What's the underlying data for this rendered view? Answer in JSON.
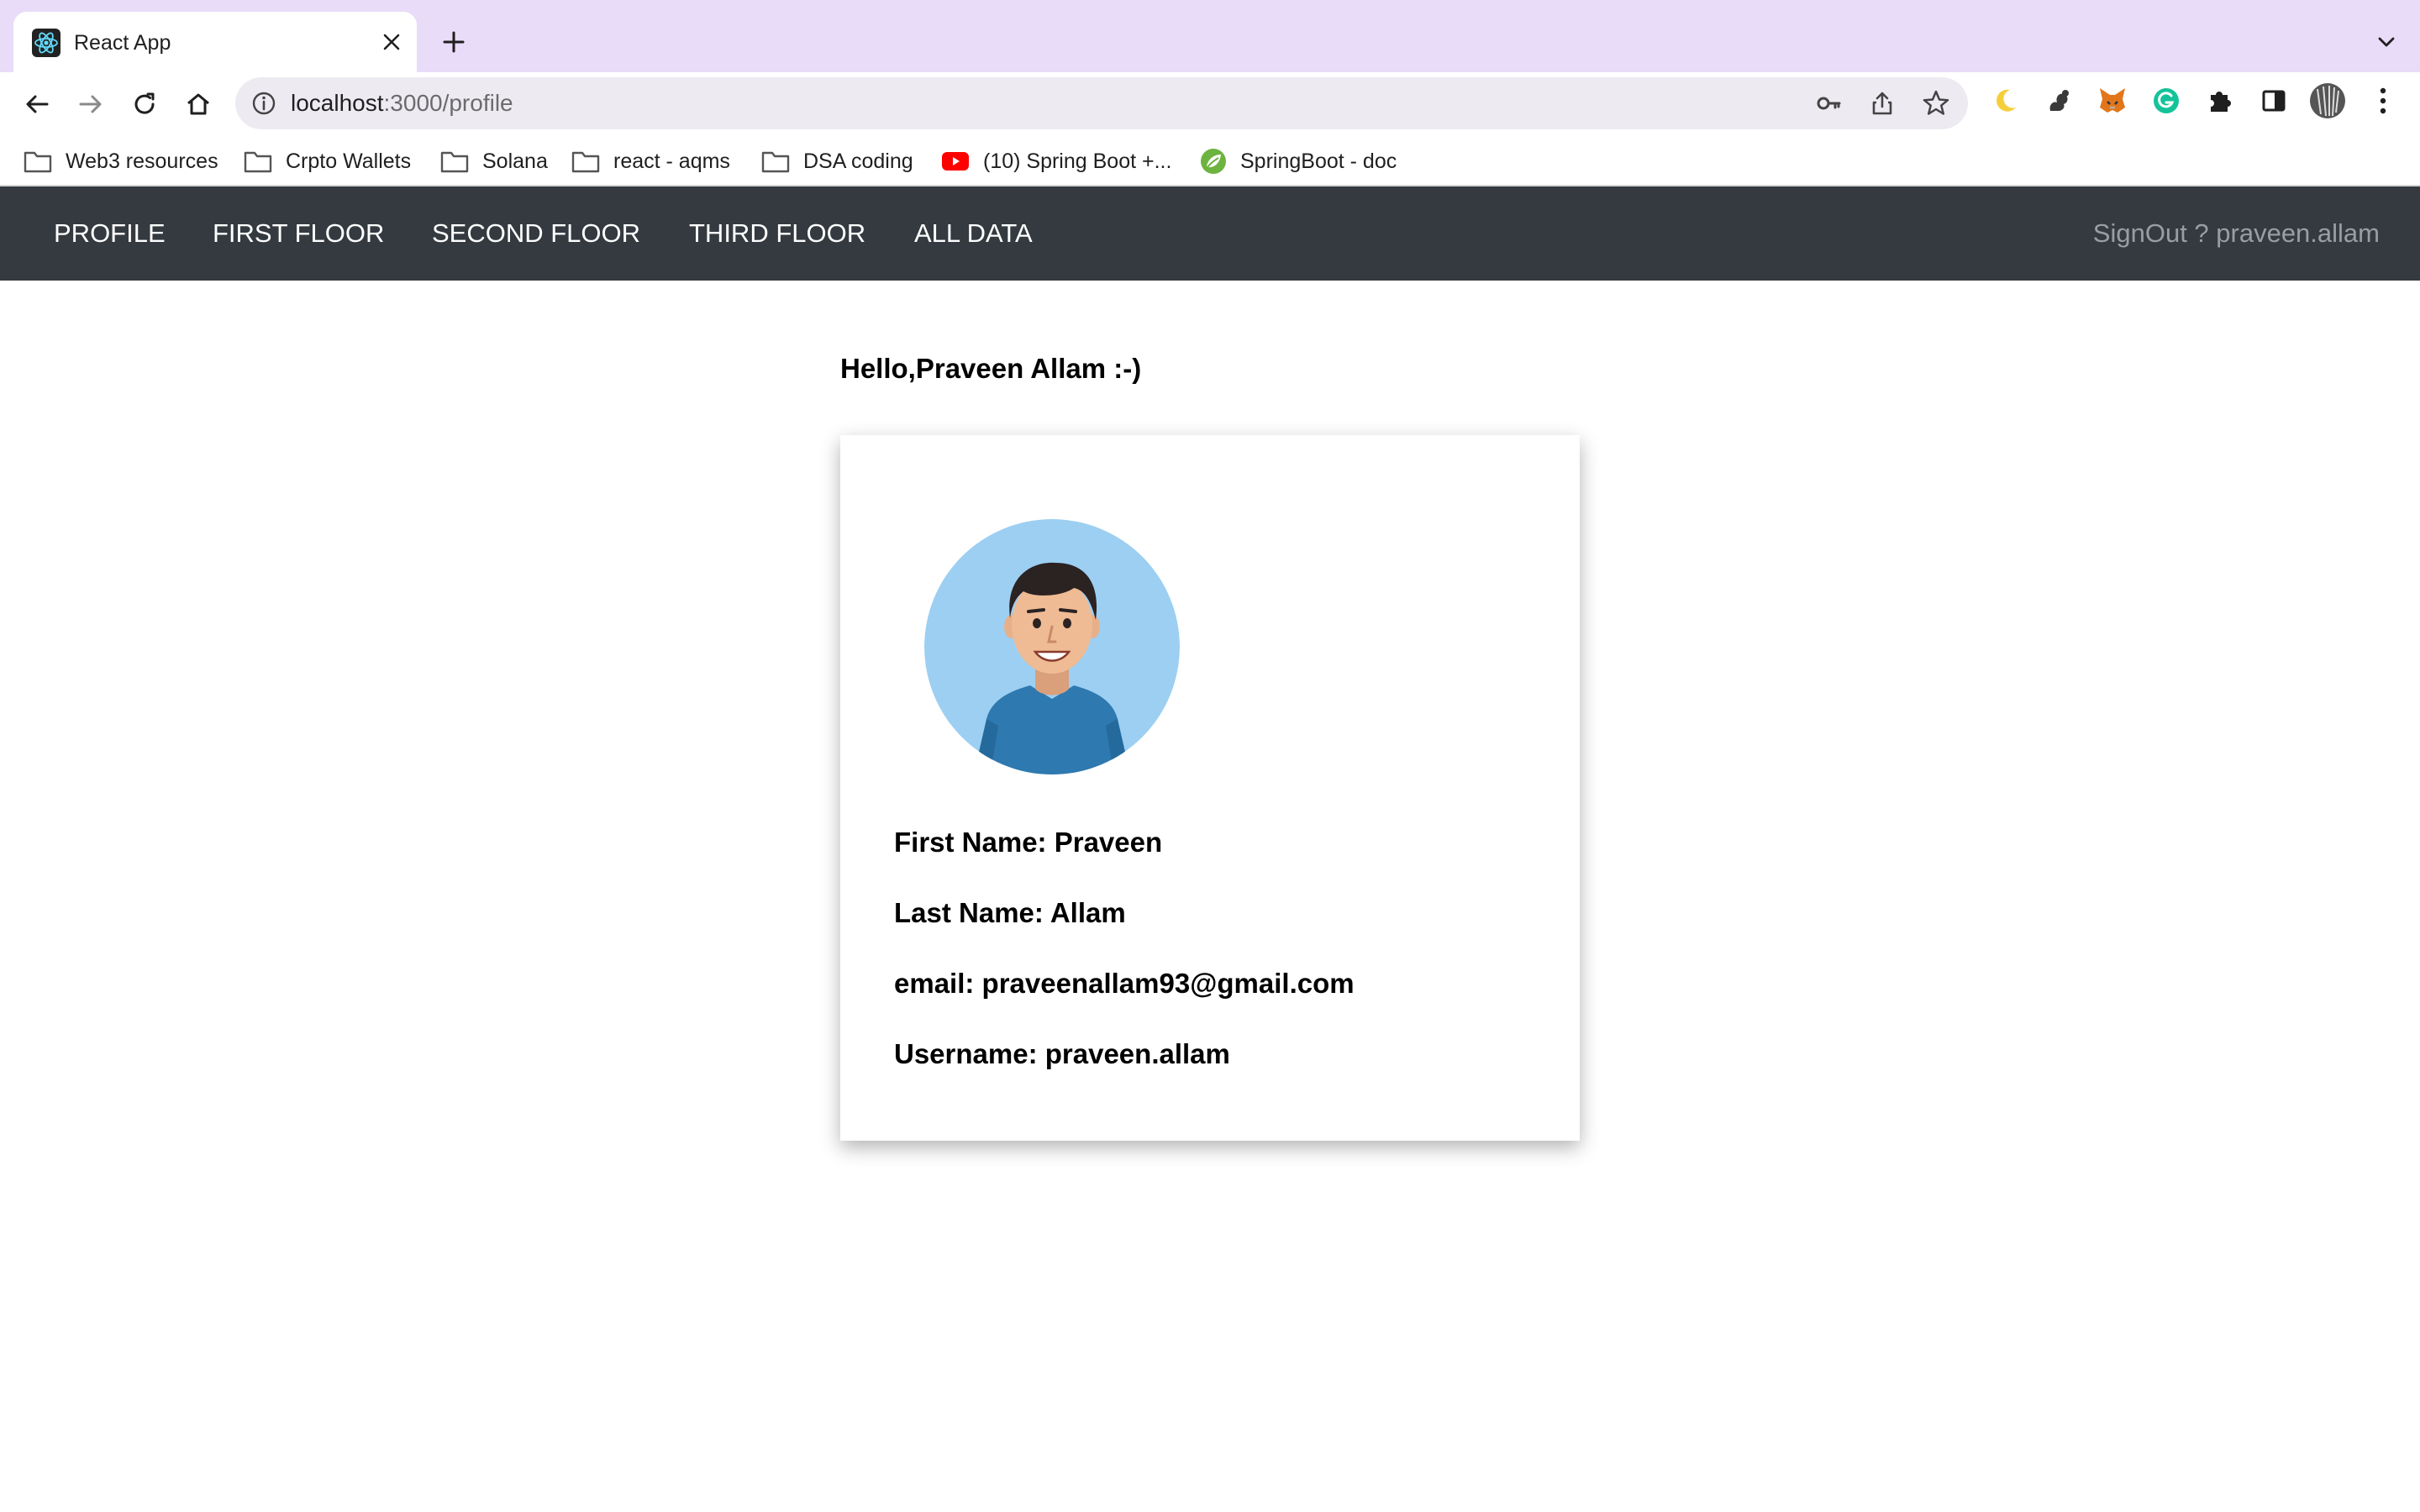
{
  "browser": {
    "tab_title": "React App",
    "url_host": "localhost",
    "url_rest": ":3000/profile",
    "bookmarks": [
      {
        "label": "Web3 resources",
        "icon": "folder-icon"
      },
      {
        "label": "Crpto Wallets",
        "icon": "folder-icon"
      },
      {
        "label": "Solana",
        "icon": "folder-icon"
      },
      {
        "label": "react - aqms",
        "icon": "folder-icon"
      },
      {
        "label": "DSA coding",
        "icon": "folder-icon"
      },
      {
        "label": "(10) Spring Boot +...",
        "icon": "youtube-icon"
      },
      {
        "label": "SpringBoot - doc",
        "icon": "spring-icon"
      }
    ]
  },
  "navbar": {
    "links": [
      "PROFILE",
      "FIRST FLOOR",
      "SECOND FLOOR",
      "THIRD FLOOR",
      "ALL DATA"
    ],
    "signout": "SignOut ? praveen.allam"
  },
  "profile": {
    "greeting": "Hello,Praveen Allam :-)",
    "first_name": "First Name: Praveen",
    "last_name": "Last Name: Allam",
    "email": "email: praveenallam93@gmail.com",
    "username": "Username: praveen.allam"
  },
  "colors": {
    "tabstrip": "#e8dcf8",
    "navbar": "#343a40",
    "avatar_bg": "#9ccff2"
  }
}
